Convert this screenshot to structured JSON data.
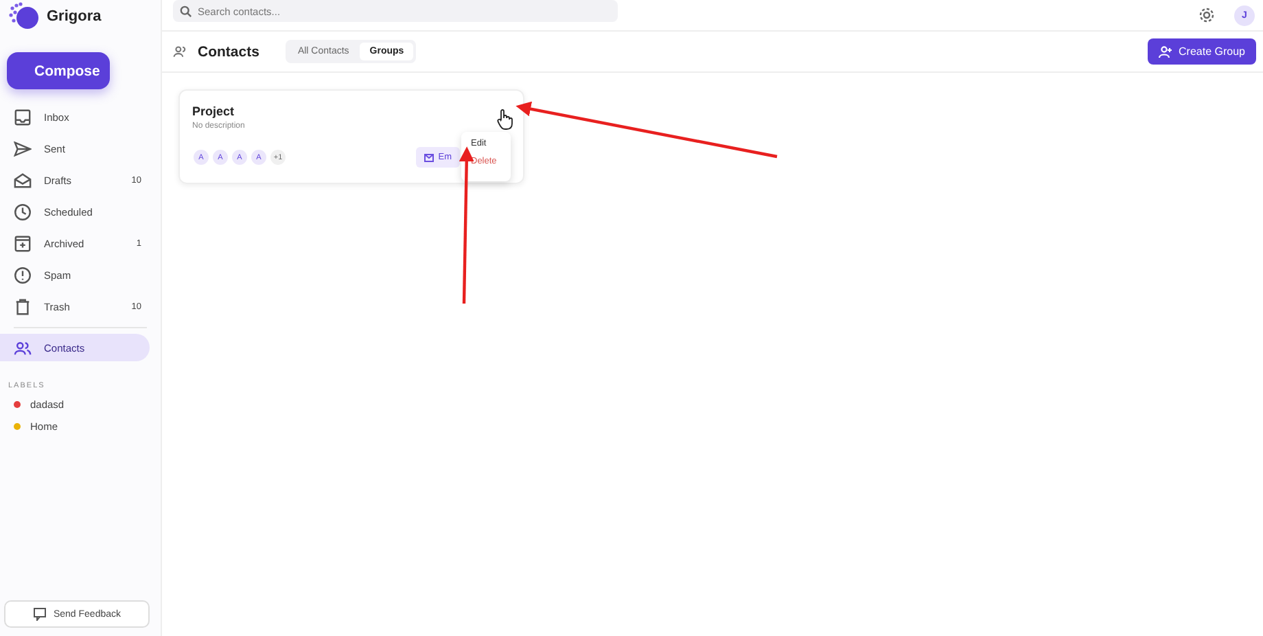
{
  "app": {
    "name": "Grigora",
    "compose": "Compose",
    "feedback": "Send Feedback"
  },
  "nav": [
    {
      "label": "Inbox",
      "selected": false
    },
    {
      "label": "Sent",
      "selected": false
    },
    {
      "label": "Drafts",
      "count": "10",
      "selected": false
    },
    {
      "label": "Scheduled",
      "selected": false
    },
    {
      "label": "Archived",
      "count": "1",
      "selected": false
    },
    {
      "label": "Spam",
      "selected": false
    },
    {
      "label": "Trash",
      "count": "10",
      "selected": false
    },
    {
      "label": "Contacts",
      "selected": true
    }
  ],
  "labels_heading": "LABELS",
  "labels": [
    {
      "name": "dadasd",
      "color": "#e53e3e"
    },
    {
      "name": "Home",
      "color": "#eab308"
    }
  ],
  "search": {
    "placeholder": "Search contacts..."
  },
  "user_initial": "J",
  "page": {
    "title": "Contacts",
    "create": "Create Group"
  },
  "tabs": [
    {
      "label": "All Contacts",
      "selected": false
    },
    {
      "label": "Groups",
      "selected": true
    }
  ],
  "group": {
    "name": "Project",
    "description": "No description",
    "members": [
      "A",
      "A",
      "A",
      "A"
    ],
    "more": "+1",
    "email": "Em"
  },
  "menu": [
    {
      "label": "Edit",
      "kind": "normal"
    },
    {
      "label": "Delete",
      "kind": "danger"
    }
  ]
}
